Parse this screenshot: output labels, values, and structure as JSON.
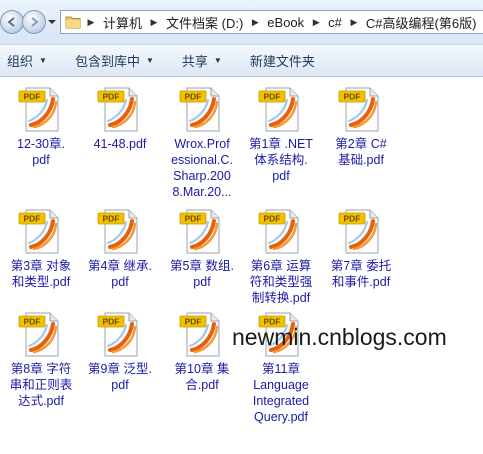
{
  "address": {
    "crumbs": [
      "计算机",
      "文件档案 (D:)",
      "eBook",
      "c#",
      "C#高级编程(第6版)"
    ]
  },
  "toolbar": {
    "organize": "组织",
    "include_library": "包含到库中",
    "share": "共享",
    "new_folder": "新建文件夹"
  },
  "files": [
    {
      "name": "12-30章.\npdf"
    },
    {
      "name": "41-48.pdf"
    },
    {
      "name": "Wrox.Prof\nessional.C.\nSharp.200\n8.Mar.20..."
    },
    {
      "name": "第1章 .NET\n体系结构.\npdf"
    },
    {
      "name": "第2章 C#\n基础.pdf"
    },
    {
      "name": "第3章 对象\n和类型.pdf"
    },
    {
      "name": "第4章 继承.\npdf"
    },
    {
      "name": "第5章 数组.\npdf"
    },
    {
      "name": "第6章 运算\n符和类型强\n制转换.pdf"
    },
    {
      "name": "第7章 委托\n和事件.pdf"
    },
    {
      "name": "第8章 字符\n串和正则表\n达式.pdf"
    },
    {
      "name": "第9章 泛型.\npdf"
    },
    {
      "name": "第10章 集\n合.pdf"
    },
    {
      "name": "第11章\nLanguage\nIntegrated\nQuery.pdf"
    }
  ],
  "watermark": "newmin.cnblogs.com",
  "colors": {
    "file_label": "#1a1aa6",
    "pdf_tag": "#f2c200",
    "accent": "#e8600c"
  }
}
